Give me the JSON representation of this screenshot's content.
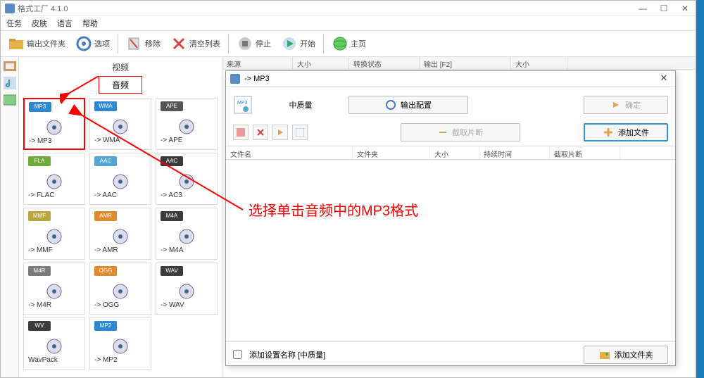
{
  "window": {
    "title": "格式工厂 4.1.0",
    "min": "—",
    "max": "☐",
    "close": "✕"
  },
  "menu": {
    "task": "任务",
    "skin": "皮肤",
    "lang": "语言",
    "help": "帮助"
  },
  "toolbar": {
    "output_folder": "输出文件夹",
    "option": "选项",
    "remove": "移除",
    "clear": "清空列表",
    "stop": "停止",
    "start": "开始",
    "home": "主页"
  },
  "categories": {
    "video": "视频",
    "audio": "音频"
  },
  "formats": [
    {
      "id": "mp3",
      "badge": "MP3",
      "badge_color": "#2d88cf",
      "label": "-> MP3",
      "selected": true
    },
    {
      "id": "wma",
      "badge": "WMA",
      "badge_color": "#2d88cf",
      "label": "-> WMA"
    },
    {
      "id": "ape",
      "badge": "APE",
      "badge_color": "#555555",
      "label": "-> APE"
    },
    {
      "id": "flac",
      "badge": "FLA",
      "badge_color": "#6fa83b",
      "label": "-> FLAC"
    },
    {
      "id": "aac",
      "badge": "AAC",
      "badge_color": "#52a6d6",
      "label": "-> AAC"
    },
    {
      "id": "ac3",
      "badge": "AAC",
      "badge_color": "#3b3b3b",
      "label": "-> AC3"
    },
    {
      "id": "mmf",
      "badge": "MMF",
      "badge_color": "#b9a63c",
      "label": "-> MMF"
    },
    {
      "id": "amr",
      "badge": "AMR",
      "badge_color": "#e08a2e",
      "label": "-> AMR"
    },
    {
      "id": "m4a",
      "badge": "M4A",
      "badge_color": "#3b3b3b",
      "label": "-> M4A"
    },
    {
      "id": "m4r",
      "badge": "M4R",
      "badge_color": "#7a7a7a",
      "label": "-> M4R"
    },
    {
      "id": "ogg",
      "badge": "OGG",
      "badge_color": "#e08a2e",
      "label": "-> OGG"
    },
    {
      "id": "wav",
      "badge": "WAV",
      "badge_color": "#3b3b3b",
      "label": "-> WAV"
    },
    {
      "id": "wv",
      "badge": "WV",
      "badge_color": "#3b3b3b",
      "label": "WavPack"
    },
    {
      "id": "mp2",
      "badge": "MP2",
      "badge_color": "#2d88cf",
      "label": "-> MP2"
    }
  ],
  "main_list": {
    "cols": {
      "source": "来源",
      "size": "大小",
      "status": "转换状态",
      "output": "输出 [F2]",
      "size2": "大小"
    }
  },
  "dialog": {
    "title": "-> MP3",
    "quality": "中质量",
    "output_config": "输出配置",
    "ok": "确定",
    "clip": "截取片断",
    "add_file": "添加文件",
    "cols": {
      "fname": "文件名",
      "folder": "文件夹",
      "size": "大小",
      "duration": "持续时间",
      "clip": "截取片断"
    },
    "add_setting": "添加设置名称 [中质量]",
    "add_folder": "添加文件夹"
  },
  "annotation": "选择单击音频中的MP3格式"
}
